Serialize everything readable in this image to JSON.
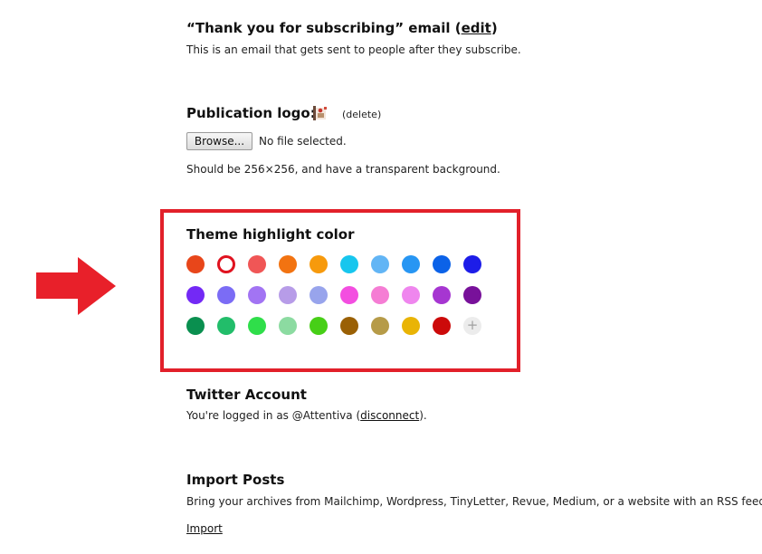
{
  "thankyou": {
    "title_prefix": "“Thank you for subscribing” email (",
    "edit_label": "edit",
    "title_suffix": ")",
    "description": "This is an email that gets sent to people after they subscribe."
  },
  "logo": {
    "title": "Publication logo:",
    "delete_label": "(delete)",
    "browse_label": "Browse...",
    "file_status": "No file selected.",
    "hint": "Should be 256×256, and have a transparent background."
  },
  "theme": {
    "title": "Theme highlight color",
    "selected_index": 1,
    "add_label": "+",
    "colors": [
      "#e8461a",
      "#ffffff",
      "#f05656",
      "#f27311",
      "#f79a0c",
      "#17c6ee",
      "#62b5f5",
      "#2796f3",
      "#0b62e8",
      "#1d1de8",
      "#7329f5",
      "#7b6cf5",
      "#a274f3",
      "#b79ce8",
      "#98a4ec",
      "#f34ee0",
      "#f57dd4",
      "#ef86ee",
      "#a636d1",
      "#78119a",
      "#0a8f4f",
      "#22bd6a",
      "#2fde4a",
      "#8cdba1",
      "#47cf17",
      "#9a6005",
      "#b69b48",
      "#e9b405",
      "#cc0a0a"
    ]
  },
  "twitter": {
    "title": "Twitter Account",
    "desc_prefix": "You're logged in as @Attentiva (",
    "disconnect_label": "disconnect",
    "desc_suffix": ")."
  },
  "import": {
    "title": "Import Posts",
    "description": "Bring your archives from Mailchimp, Wordpress, TinyLetter, Revue, Medium, or a website with an RSS feed",
    "link_label": "Import"
  },
  "colors": {
    "highlight_border": "#e2202a",
    "arrow": "#e8202a",
    "selected_ring": "#e0121f"
  },
  "icons": {
    "arrow": "arrow-right-icon",
    "logo": "publication-logo-image"
  }
}
